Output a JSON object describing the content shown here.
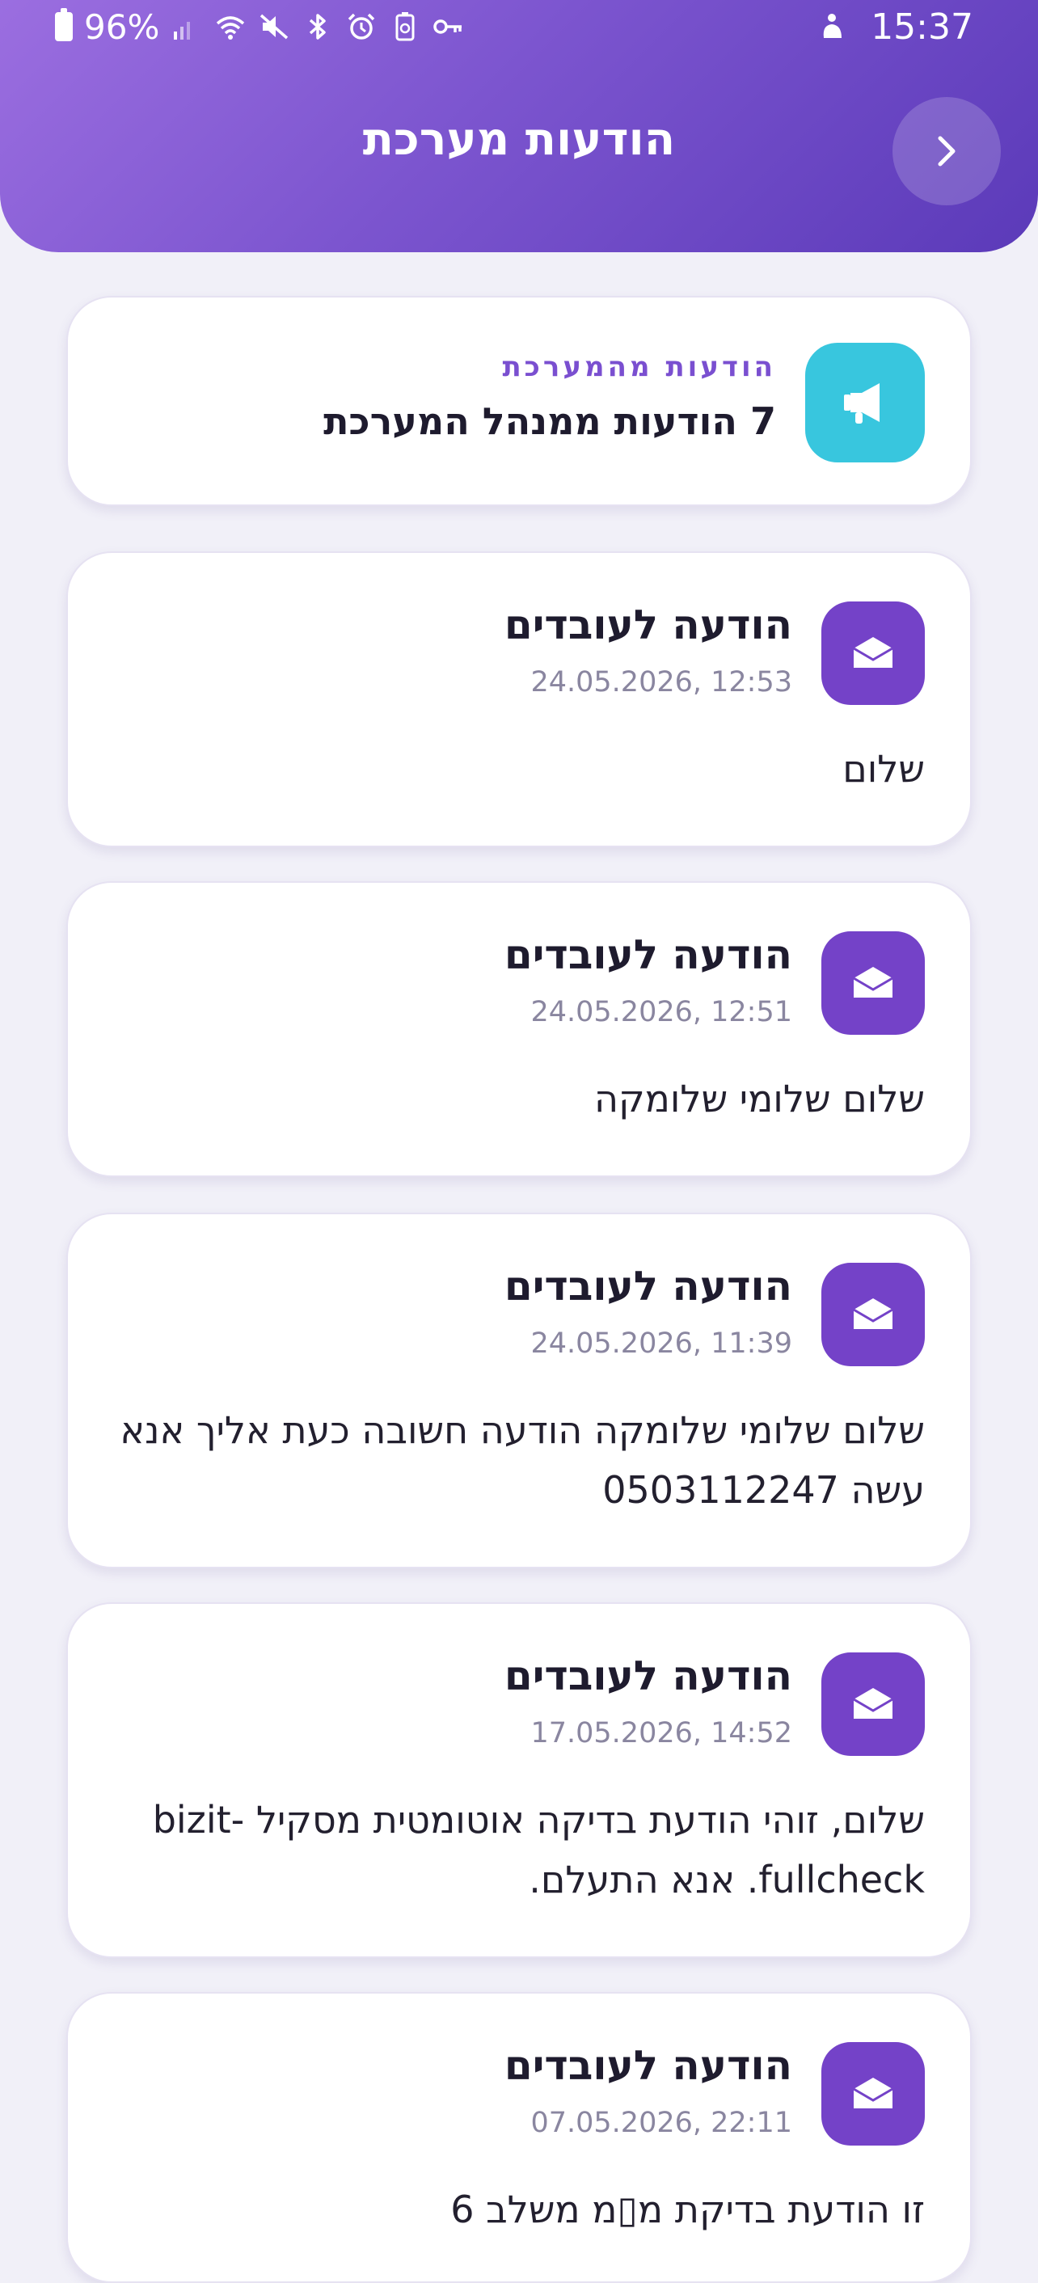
{
  "status_bar": {
    "battery": "96%",
    "time": "15:37"
  },
  "header": {
    "title": "הודעות מערכת",
    "back_icon": "chevron-right-icon"
  },
  "summary": {
    "kicker": "הודעות מהמערכת",
    "text": "7 הודעות ממנהל המערכת",
    "icon": "megaphone-icon",
    "icon_color": "#38c6de"
  },
  "messages": [
    {
      "title": "הודעה לעובדים",
      "date": "24.05.2026, 12:53",
      "body": "שלום"
    },
    {
      "title": "הודעה לעובדים",
      "date": "24.05.2026, 12:51",
      "body": "שלום שלומי שלומקה"
    },
    {
      "title": "הודעה לעובדים",
      "date": "24.05.2026, 11:39",
      "body": "שלום שלומי שלומקה הודעה חשובה כעת אליך אנא עשה 0503112247"
    },
    {
      "title": "הודעה לעובדים",
      "date": "17.05.2026, 14:52",
      "body": "שלום, זוהי הודעת בדיקה אוטומטית מסקיל bizit-fullcheck. אנא התעלם."
    },
    {
      "title": "הודעה לעובדים",
      "date": "07.05.2026, 22:11",
      "body": "זו הודעת בדיקת מ▯מ משלב 6"
    }
  ],
  "colors": {
    "accent": "#7442c8",
    "header_start": "#9b6ee0",
    "header_end": "#5b3ab9",
    "background": "#f1f0f8"
  }
}
